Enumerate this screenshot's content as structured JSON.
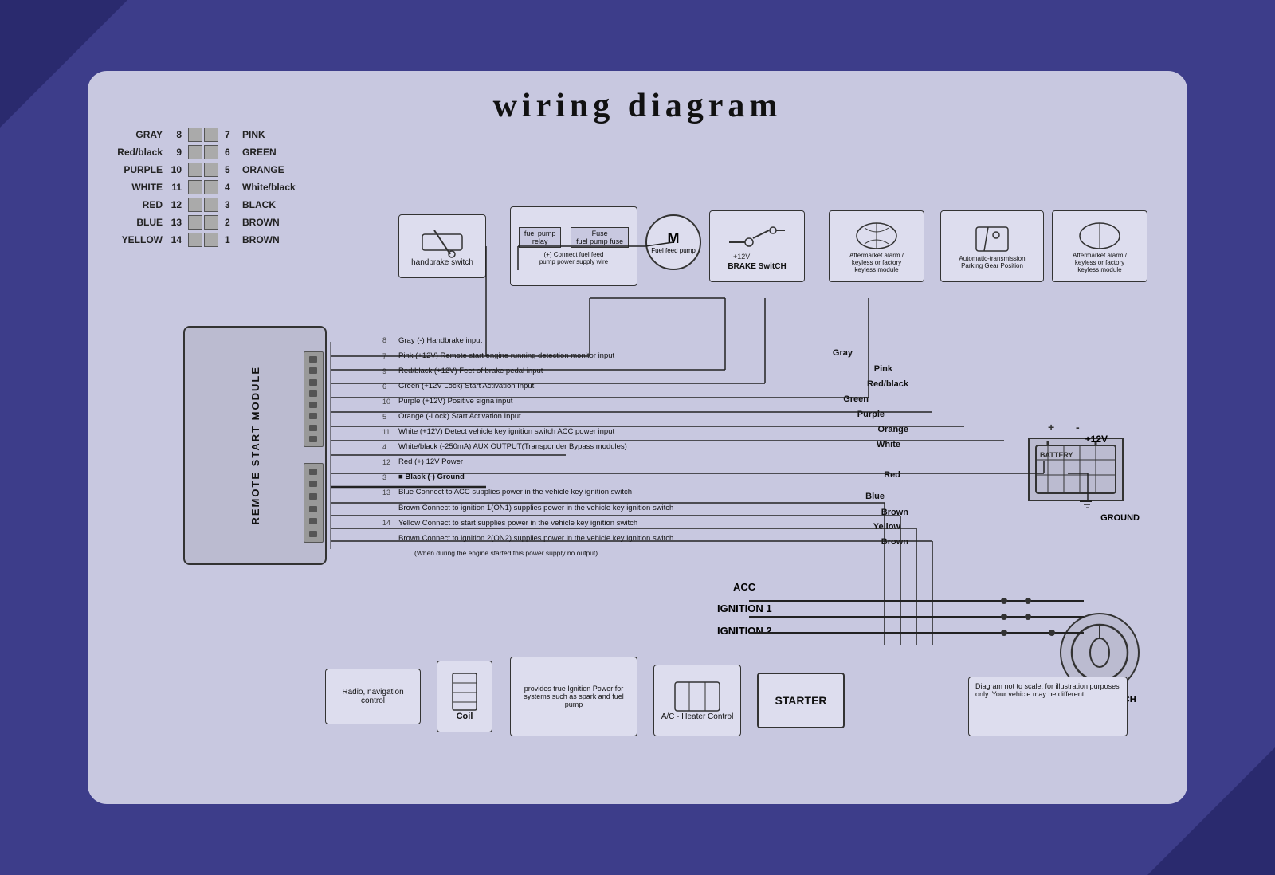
{
  "title": "wiring  diagram",
  "pin_rows": [
    {
      "left_label": "GRAY",
      "left_num": "8",
      "right_num": "7",
      "right_label": "PINK"
    },
    {
      "left_label": "Red/black",
      "left_num": "9",
      "right_num": "6",
      "right_label": "GREEN"
    },
    {
      "left_label": "PURPLE",
      "left_num": "10",
      "right_num": "5",
      "right_label": "ORANGE"
    },
    {
      "left_label": "WHITE",
      "left_num": "11",
      "right_num": "4",
      "right_label": "White/black"
    },
    {
      "left_label": "RED",
      "left_num": "12",
      "right_num": "3",
      "right_label": "BLACK"
    },
    {
      "left_label": "BLUE",
      "left_num": "13",
      "right_num": "2",
      "right_label": "BROWN"
    },
    {
      "left_label": "YELLOW",
      "left_num": "14",
      "right_num": "1",
      "right_label": "BROWN"
    }
  ],
  "module_label": "REMOTE START MODULE",
  "components": {
    "handbrake": "handbrake switch",
    "fuel_pump_relay": "fuel pump\nrelay",
    "fuel_pump_fuse_label": "Fuse\nfuel pump fuse",
    "fuel_pump_desc": "(+) Connect fuel feed\npump power supply wire",
    "motor_label": "M",
    "fuel_feed_label": "Fuel feed pump",
    "brake_switch": "BRAKE SwitCH",
    "aftermarket_alarm1_label": "Aftermarket alarm /\nkeyless or factory\nkeyless module",
    "auto_trans_label": "Automatic-transmission\nParking Gear Position",
    "aftermarket_alarm2_label": "Aftermarket alarm /\nkeyless or factory\nkeyless module",
    "battery_label": "BATTERY",
    "plus12v_label": "+12V",
    "ground_label": "GROUND",
    "ignition_switch_label": "IGNITION SWITCH",
    "acc_label": "ACC",
    "ignition1_label": "IGNITION 1",
    "ignition2_label": "IGNITION 2",
    "radio_label": "Radio, navigation\ncontrol",
    "coil_label": "Coil",
    "provides_label": "provides true Ignition\nPower for systems such\nas spark and fuel pump",
    "ac_heater_label": "A/C - Heater\nControl",
    "starter_label": "STARTER",
    "note_label": "Diagram not to scale, for illustration\npurposes only. Your vehicle may be\ndifferent"
  },
  "wire_descriptions": [
    {
      "num": "8",
      "text": "Gray  (-) Handbrake input",
      "bold": false,
      "color_end": "Gray"
    },
    {
      "num": "7",
      "text": "Pink  (+12V) Remote start engine running detection monitor input",
      "bold": false,
      "color_end": "Pink"
    },
    {
      "num": "9",
      "text": "Red/black  (+12V) Feet of brake pedal input",
      "bold": false,
      "color_end": "Red/black"
    },
    {
      "num": "6",
      "text": "Green  (+12V Lock) Start Activation Input",
      "bold": false,
      "color_end": "Green"
    },
    {
      "num": "10",
      "text": "Purple  (+12V) Positive signa input",
      "bold": false,
      "color_end": "Purple"
    },
    {
      "num": "5",
      "text": "Orange  (-Lock)  Start Activation Input",
      "bold": false,
      "color_end": "Orange"
    },
    {
      "num": "11",
      "text": "White  (+12V) Detect vehicle key ignition switch ACC power input",
      "bold": false,
      "color_end": "White"
    },
    {
      "num": "4",
      "text": "White/black  (-250mA) AUX OUTPUT(Transponder Bypass modules)",
      "bold": false,
      "color_end": ""
    },
    {
      "num": "12",
      "text": "Red  (+) 12V Power",
      "bold": false,
      "color_end": "Red"
    },
    {
      "num": "3",
      "text": "■  Black (-) Ground",
      "bold": true,
      "color_end": ""
    },
    {
      "num": "13",
      "text": "Blue  Connect to ACC supplies power in the vehicle key ignition switch",
      "bold": false,
      "color_end": "Blue"
    },
    {
      "num": "1_brown1",
      "text": "Brown  Connect to ignition 1(ON1) supplies power in the vehicle key ignition switch",
      "bold": false,
      "color_end": "Brown"
    },
    {
      "num": "14",
      "text": "Yellow  Connect to start supplies power in the vehicle key ignition switch",
      "bold": false,
      "color_end": "Yellow"
    },
    {
      "num": "1_brown2",
      "text": "Brown  Connect to ignition 2(ON2) supplies power in the vehicle key ignition switch",
      "bold": false,
      "color_end": "Brown"
    },
    {
      "num": "",
      "text": "(When during the engine started this power supply no output)",
      "bold": false,
      "color_end": ""
    }
  ],
  "colors": {
    "background": "#3d3d8a",
    "card": "#c8c8e0",
    "component_bg": "#dde",
    "module_bg": "#bbbbd0",
    "wire": "#222"
  }
}
